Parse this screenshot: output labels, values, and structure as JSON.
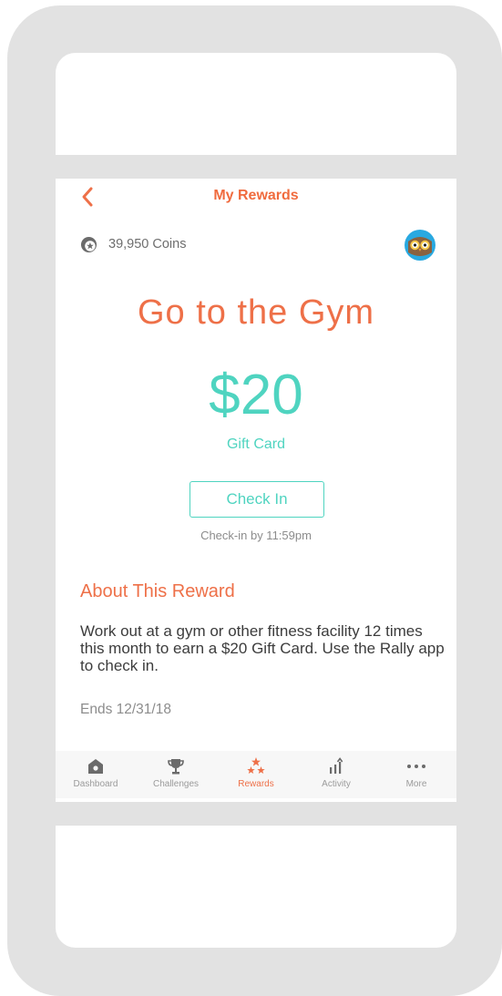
{
  "nav": {
    "title": "My Rewards",
    "back_icon": "chevron-left-icon"
  },
  "account": {
    "coins_text": "39,950 Coins",
    "coin_icon": "coin-star-icon",
    "avatar_icon": "owl-avatar-icon"
  },
  "reward": {
    "title": "Go to the Gym",
    "amount": "$20",
    "type": "Gift Card",
    "checkin_label": "Check In",
    "checkin_note": "Check-in by 11:59pm"
  },
  "about": {
    "heading": "About This Reward",
    "body": "Work out at a gym or other fitness facility 12 times this month to earn a $20 Gift Card. Use the Rally app to check in.",
    "ends": "Ends 12/31/18"
  },
  "tabs": [
    {
      "label": "Dashboard",
      "icon": "home-icon",
      "active": false
    },
    {
      "label": "Challenges",
      "icon": "trophy-icon",
      "active": false
    },
    {
      "label": "Rewards",
      "icon": "stars-icon",
      "active": true
    },
    {
      "label": "Activity",
      "icon": "bar-chart-icon",
      "active": false
    },
    {
      "label": "More",
      "icon": "more-dots-icon",
      "active": false
    }
  ],
  "colors": {
    "accent_orange": "#ee7048",
    "accent_teal": "#4fd4c0",
    "frame_gray": "#e2e2e2"
  }
}
